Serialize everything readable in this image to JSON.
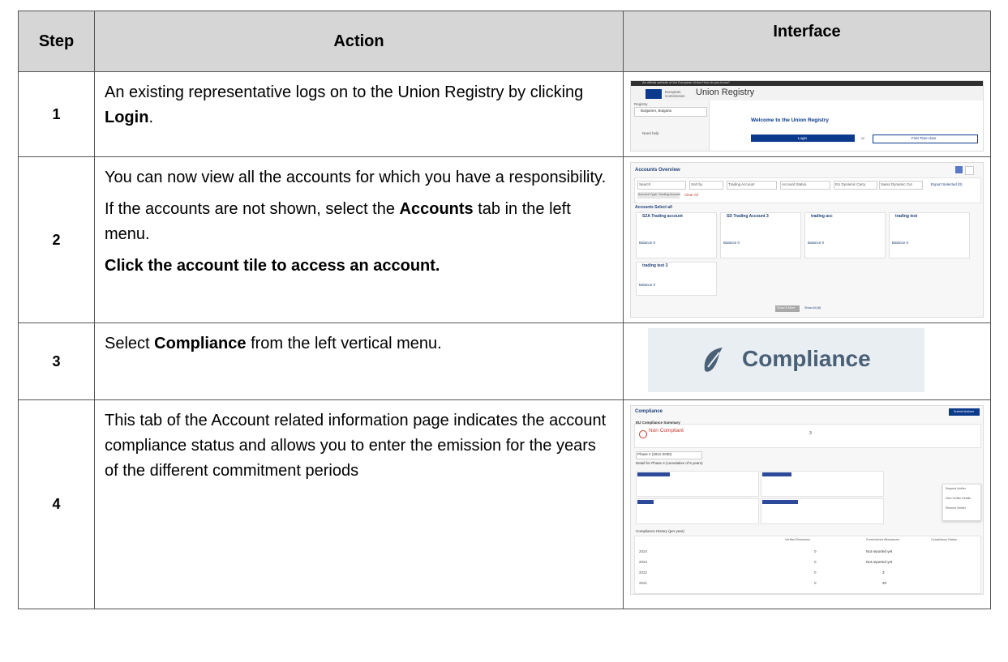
{
  "headers": {
    "step": "Step",
    "action": "Action",
    "interface": "Interface"
  },
  "rows": [
    {
      "step": "1",
      "action_parts": [
        "An existing representative logs on to the Union Registry by clicking ",
        "Login",
        "."
      ],
      "interface": {
        "banner": "An official website of the European Union   How do you know?",
        "logo_text": "European Commission",
        "registry_title": "Union Registry",
        "registry_label": "Registry",
        "registry_select": "Bulgarien, Bulgaria",
        "need_help": "Need help",
        "welcome": "Welcome to the Union Registry",
        "login_button": "Login",
        "or": "or",
        "first_time_user": "First Time User"
      }
    },
    {
      "step": "2",
      "action_paragraphs": [
        [
          "You can now view all the accounts for which you have a responsibility."
        ],
        [
          "If the accounts are not shown, select the ",
          "Accounts",
          " tab in the left menu."
        ],
        [
          "Click the account tile to access an account."
        ]
      ],
      "interface": {
        "title": "Accounts Overview",
        "filters": [
          "Search",
          "Sort by",
          "Trading Account",
          "Account Status",
          "EU Dynamic Carry",
          "Swiss Dynamic Cut"
        ],
        "export": "Export Selected (0)",
        "chip": "Account Type: Trading Account",
        "clear": "Clear All",
        "accounts_label": "Accounts  Select all",
        "tiles": [
          {
            "name": "SZA Trading account",
            "balance": "Balance 0"
          },
          {
            "name": "SD Trading Account 3",
            "balance": "Balance 0"
          },
          {
            "name": "trading acc",
            "balance": "Balance 0"
          },
          {
            "name": "trading test",
            "balance": "Balance 0"
          },
          {
            "name": "trading test 3",
            "balance": "Balance 0"
          }
        ],
        "show_more": "Show 8 More",
        "show_all": "Show All (8)"
      }
    },
    {
      "step": "3",
      "action_parts": [
        "Select ",
        "Compliance",
        " from the left vertical menu."
      ],
      "interface": {
        "label": "Compliance"
      }
    },
    {
      "step": "4",
      "action_text": "This tab of the Account related information page indicates the account compliance status and allows you to enter the emission for the years of the different commitment periods",
      "interface": {
        "title": "Compliance",
        "button": "Submit Actions",
        "summary": "EU Compliance Summary",
        "status": "Non Compliant",
        "status_value": "3",
        "period": "Phase 4 (2021-2030)",
        "details": "Detail for Phase 4 (cumulative of 5 years)",
        "history": "Compliance History (per year)",
        "history_headers": [
          "Verified Emissions",
          "Surrendered Allowances",
          "Compliance Status"
        ],
        "history_rows": [
          {
            "year": "2024",
            "emissions": "0",
            "status": "Not reported yet"
          },
          {
            "year": "2023",
            "emissions": "0",
            "status": "Not reported yet"
          },
          {
            "year": "2022",
            "emissions": "0",
            "status": "3"
          },
          {
            "year": "2021",
            "emissions": "0",
            "status": "20"
          }
        ],
        "menu": [
          "Request Verifier",
          "View Verifier Details",
          "Remove Verifier"
        ]
      }
    }
  ],
  "colors": {
    "header_bg": "#d6d6d6",
    "brand_blue": "#0b3a8c",
    "compliance_text": "#4a6076"
  }
}
